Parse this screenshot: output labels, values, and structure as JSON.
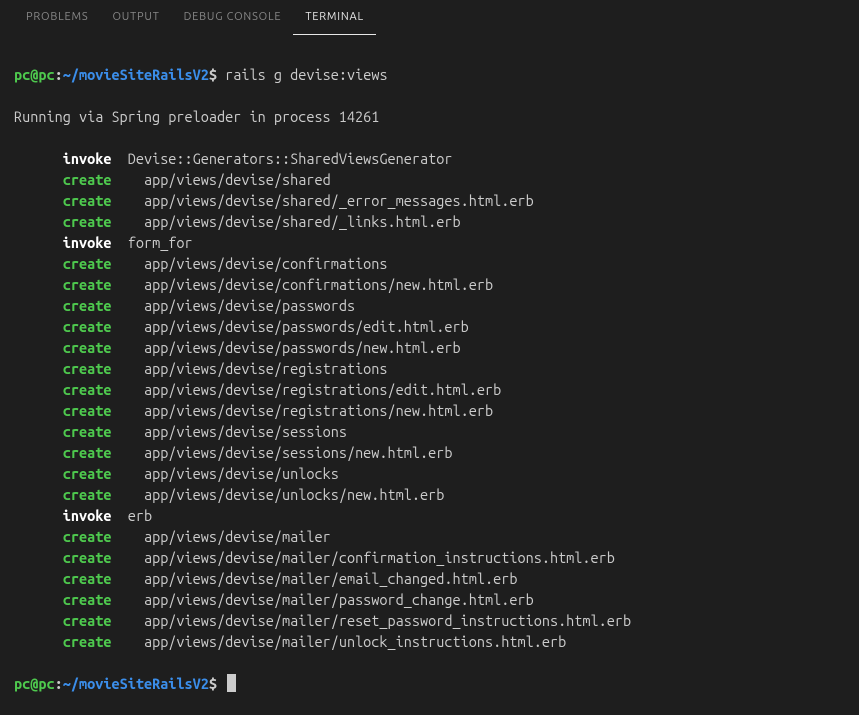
{
  "tabs": {
    "problems": "PROBLEMS",
    "output": "OUTPUT",
    "debug": "DEBUG CONSOLE",
    "terminal": "TERMINAL"
  },
  "prompt": {
    "user": "pc",
    "at": "@",
    "host": "pc",
    "colon": ":",
    "path": "~/movieSiteRailsV2",
    "dollar": "$"
  },
  "cmd1": " rails g devise:views",
  "run": "Running via Spring preloader in process 14261",
  "lines": [
    {
      "k": "invoke",
      "kc": "bwhite",
      "p": "",
      "v": "Devise::Generators::SharedViewsGenerator"
    },
    {
      "k": "create",
      "kc": "bgreen",
      "p": "  ",
      "v": "app/views/devise/shared"
    },
    {
      "k": "create",
      "kc": "bgreen",
      "p": "  ",
      "v": "app/views/devise/shared/_error_messages.html.erb"
    },
    {
      "k": "create",
      "kc": "bgreen",
      "p": "  ",
      "v": "app/views/devise/shared/_links.html.erb"
    },
    {
      "k": "invoke",
      "kc": "bwhite",
      "p": "",
      "v": "form_for"
    },
    {
      "k": "create",
      "kc": "bgreen",
      "p": "  ",
      "v": "app/views/devise/confirmations"
    },
    {
      "k": "create",
      "kc": "bgreen",
      "p": "  ",
      "v": "app/views/devise/confirmations/new.html.erb"
    },
    {
      "k": "create",
      "kc": "bgreen",
      "p": "  ",
      "v": "app/views/devise/passwords"
    },
    {
      "k": "create",
      "kc": "bgreen",
      "p": "  ",
      "v": "app/views/devise/passwords/edit.html.erb"
    },
    {
      "k": "create",
      "kc": "bgreen",
      "p": "  ",
      "v": "app/views/devise/passwords/new.html.erb"
    },
    {
      "k": "create",
      "kc": "bgreen",
      "p": "  ",
      "v": "app/views/devise/registrations"
    },
    {
      "k": "create",
      "kc": "bgreen",
      "p": "  ",
      "v": "app/views/devise/registrations/edit.html.erb"
    },
    {
      "k": "create",
      "kc": "bgreen",
      "p": "  ",
      "v": "app/views/devise/registrations/new.html.erb"
    },
    {
      "k": "create",
      "kc": "bgreen",
      "p": "  ",
      "v": "app/views/devise/sessions"
    },
    {
      "k": "create",
      "kc": "bgreen",
      "p": "  ",
      "v": "app/views/devise/sessions/new.html.erb"
    },
    {
      "k": "create",
      "kc": "bgreen",
      "p": "  ",
      "v": "app/views/devise/unlocks"
    },
    {
      "k": "create",
      "kc": "bgreen",
      "p": "  ",
      "v": "app/views/devise/unlocks/new.html.erb"
    },
    {
      "k": "invoke",
      "kc": "bwhite",
      "p": "",
      "v": "erb"
    },
    {
      "k": "create",
      "kc": "bgreen",
      "p": "  ",
      "v": "app/views/devise/mailer"
    },
    {
      "k": "create",
      "kc": "bgreen",
      "p": "  ",
      "v": "app/views/devise/mailer/confirmation_instructions.html.erb"
    },
    {
      "k": "create",
      "kc": "bgreen",
      "p": "  ",
      "v": "app/views/devise/mailer/email_changed.html.erb"
    },
    {
      "k": "create",
      "kc": "bgreen",
      "p": "  ",
      "v": "app/views/devise/mailer/password_change.html.erb"
    },
    {
      "k": "create",
      "kc": "bgreen",
      "p": "  ",
      "v": "app/views/devise/mailer/reset_password_instructions.html.erb"
    },
    {
      "k": "create",
      "kc": "bgreen",
      "p": "  ",
      "v": "app/views/devise/mailer/unlock_instructions.html.erb"
    }
  ]
}
